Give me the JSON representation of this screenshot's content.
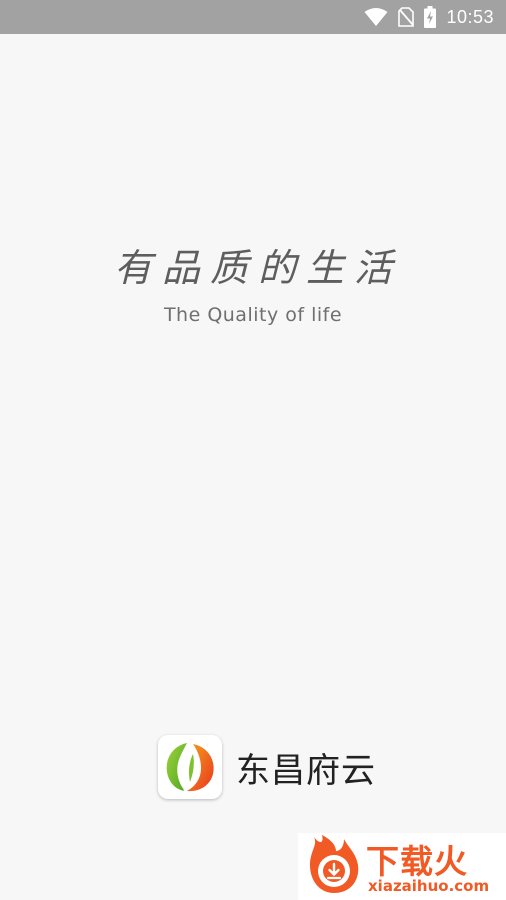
{
  "status_bar": {
    "time": "10:53",
    "icons": [
      "wifi-icon",
      "no-sim-icon",
      "battery-charging-icon"
    ]
  },
  "slogan": {
    "chinese": "有品质的生活",
    "english": "The Quality of life"
  },
  "brand": {
    "logo_icon": "leaf-logo-icon",
    "name": "东昌府云"
  },
  "watermark": {
    "title": "下载火",
    "url": "xiazaihuo.com"
  },
  "colors": {
    "background": "#f7f7f7",
    "status_bar": "#a2a2a2",
    "leaf_green": "#6ab82d",
    "leaf_orange": "#f0562a",
    "watermark_orange": "#f15a24"
  }
}
